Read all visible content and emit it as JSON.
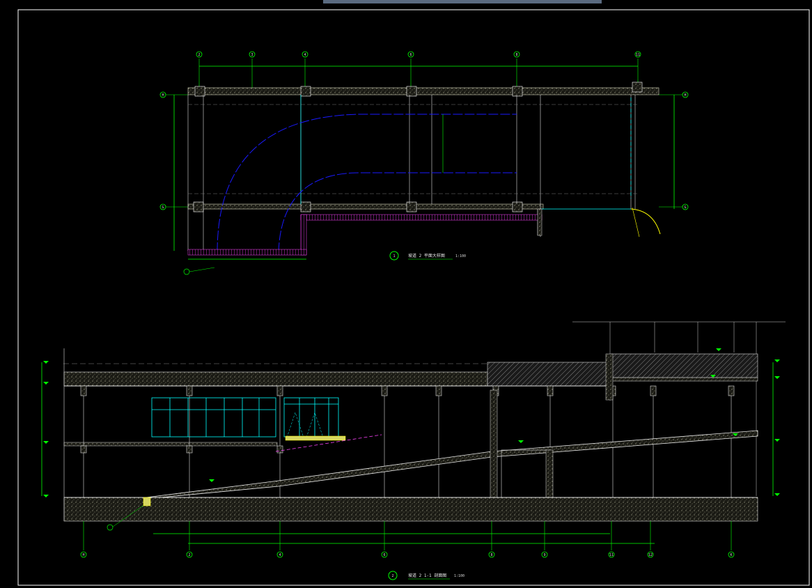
{
  "window": {
    "tab_indicator": "drawing-tab"
  },
  "colors": {
    "background": "#000000",
    "frame": "#ffffff",
    "structure": "#f0f0f0",
    "dimension": "#00ff00",
    "path": "#1a1aff",
    "glass": "#00ffff",
    "hatch": "#ff44ff",
    "wall_fill": "#c8c8b0",
    "callout": "#ffff00"
  },
  "plan": {
    "grid_axes": [
      "2",
      "3",
      "4",
      "6",
      "8",
      "11"
    ],
    "row_axes": [
      "H",
      "G"
    ],
    "title_number": "1",
    "title": "坡道 2 平面大样图",
    "scale": "1:100"
  },
  "section": {
    "grid_axes": [
      "H",
      "2",
      "4",
      "6",
      "8",
      "9",
      "11",
      "12",
      "K"
    ],
    "title_number": "2",
    "title": "坡道 2 1-1 剖面图",
    "scale": "1:100"
  },
  "icons": {
    "plan_title_marker": "circle-number-icon",
    "section_title_marker": "circle-number-icon"
  }
}
